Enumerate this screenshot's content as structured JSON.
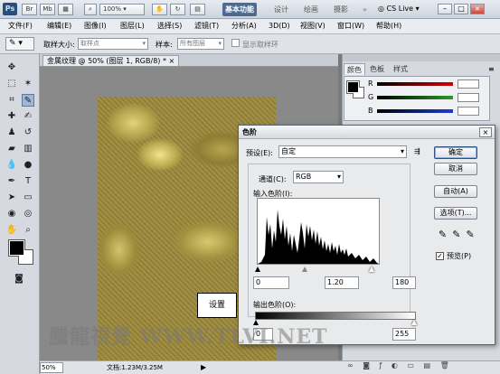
{
  "titlebar": {
    "logo": "Ps",
    "zoom": "100%",
    "workspace_tabs": [
      "基本功能",
      "设计",
      "绘画",
      "摄影"
    ],
    "cs_live": "CS Live"
  },
  "menubar": {
    "items": [
      "文件(F)",
      "编辑(E)",
      "图像(I)",
      "图层(L)",
      "选择(S)",
      "滤镜(T)",
      "分析(A)",
      "3D(D)",
      "视图(V)",
      "窗口(W)",
      "帮助(H)"
    ]
  },
  "options": {
    "sample_size_label": "取样大小:",
    "sample_size_value": "取样点",
    "sample_label": "样本:",
    "sample_value": "所有图层",
    "show_ring_label": "显示取样环"
  },
  "document": {
    "tab_title": "金属纹理 @ 50% (图层 1, RGB/8) *",
    "zoom": "50%",
    "doc_info": "文档:1.23M/3.25M"
  },
  "panel": {
    "tabs": [
      "颜色",
      "色板",
      "样式"
    ],
    "channels": [
      "R",
      "G",
      "B"
    ]
  },
  "levels": {
    "title": "色阶",
    "preset_label": "预设(E):",
    "preset_value": "自定",
    "channel_label": "通道(C):",
    "channel_value": "RGB",
    "input_label": "输入色阶(I):",
    "input_black": "0",
    "input_gamma": "1.20",
    "input_white": "180",
    "output_label": "输出色阶(O):",
    "output_black": "0",
    "output_white": "255",
    "buttons": {
      "ok": "确定",
      "cancel": "取消",
      "auto": "自动(A)",
      "options": "选项(T)..."
    },
    "preview_label": "预览(P)",
    "preview_checked": true
  },
  "callout": "设置",
  "watermark": "騰龍視覺 WWW.TLVI.NET",
  "colors": {
    "accent": "#4d6b90",
    "red": "#d40000",
    "green": "#2a9a2a",
    "blue": "#1a3fd0"
  }
}
